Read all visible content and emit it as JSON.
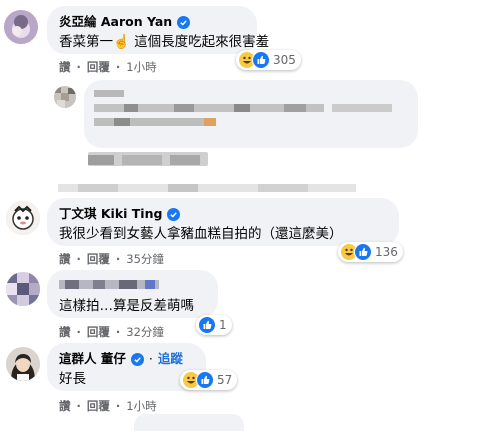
{
  "comments": [
    {
      "name": "炎亞綸 Aaron Yan",
      "verified": true,
      "text": "香菜第一☝️  這個長度吃起來很害羞",
      "actions": {
        "like": "讚",
        "reply": "回覆",
        "time": "1小時"
      },
      "reaction_count": "305"
    },
    {
      "name": "丁文琪 Kiki Ting",
      "verified": true,
      "text": "我很少看到女藝人拿豬血糕自拍的（還這麼美）",
      "actions": {
        "like": "讚",
        "reply": "回覆",
        "time": "35分鐘"
      },
      "reaction_count": "136"
    },
    {
      "text": "這樣拍…算是反差萌嗎",
      "actions": {
        "like": "讚",
        "reply": "回覆",
        "time": "32分鐘"
      },
      "reaction_count": "1"
    },
    {
      "name": "這群人 董仔",
      "verified": true,
      "follow_label": "追蹤",
      "text": "好長",
      "actions": {
        "like": "讚",
        "reply": "回覆",
        "time": "1小時"
      },
      "reaction_count": "57"
    }
  ],
  "separator": "·",
  "colors": {
    "bubble": "#f0f2f5",
    "verified_blue": "#1877f2",
    "muted_text": "#65676b",
    "like_blue": "#1877f2",
    "haha_yellow": "#f7c944"
  },
  "icons": [
    "verified-badge-icon",
    "haha-reaction-icon",
    "like-reaction-icon"
  ]
}
